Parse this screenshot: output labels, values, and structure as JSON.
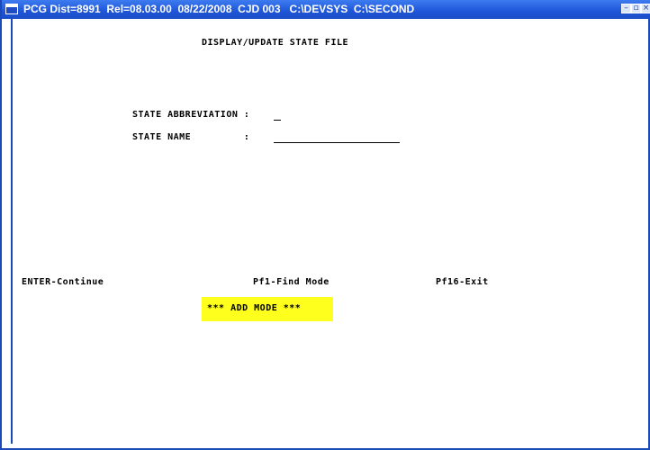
{
  "window": {
    "title": "PCG Dist=8991  Rel=08.03.00  08/22/2008  CJD 003   C:\\DEVSYS  C:\\SECOND",
    "controls": [
      "minimize-icon",
      "restore-icon",
      "close-icon"
    ]
  },
  "screen": {
    "heading": "DISPLAY/UPDATE STATE FILE",
    "fields": [
      {
        "label": "STATE ABBREVIATION :",
        "value": ""
      },
      {
        "label": "STATE NAME         :",
        "value": ""
      }
    ],
    "function_keys": [
      "ENTER-Continue",
      "Pf1-Find Mode",
      "Pf16-Exit"
    ],
    "mode_banner": "*** ADD MODE ***"
  },
  "colors": {
    "titlebar": "#1f56d8",
    "banner": "#ffff1e",
    "border": "#1c49b8"
  }
}
